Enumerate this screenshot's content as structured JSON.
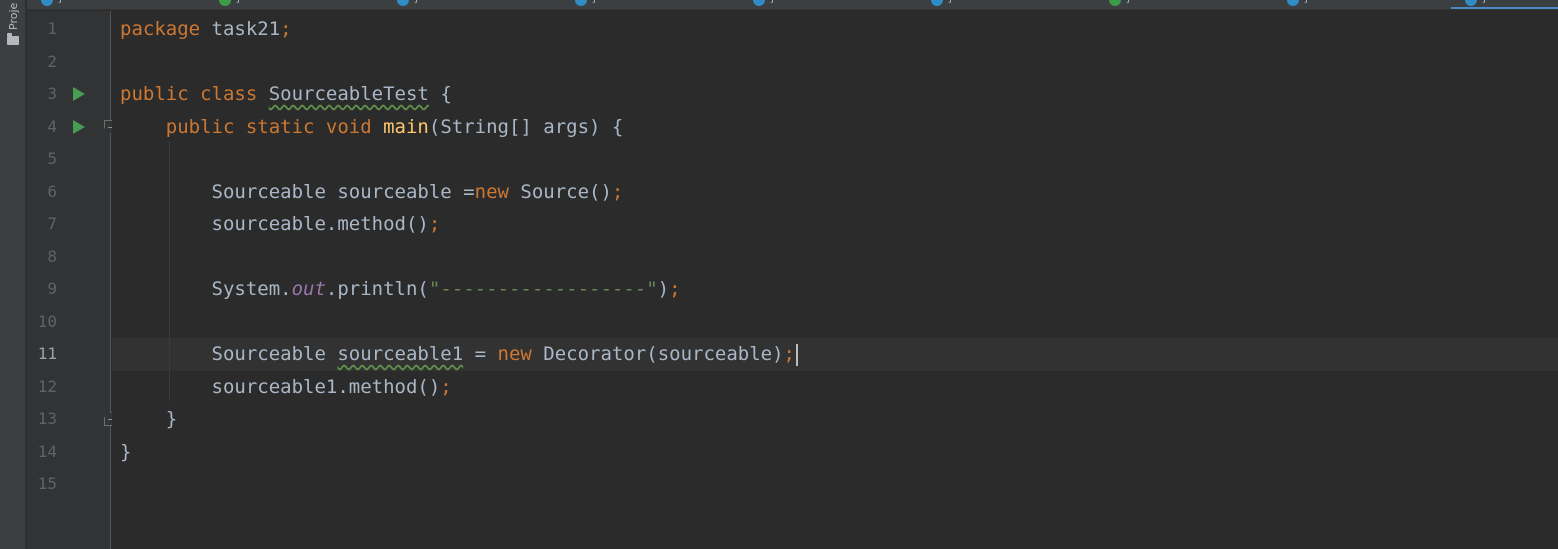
{
  "tool_window": {
    "project_label": "Proje",
    "folder_icon": "folder-icon"
  },
  "tabs": [
    {
      "label": "j",
      "dot_color": "#2f8cc4",
      "active": false
    },
    {
      "label": "j",
      "dot_color": "#3e9b45",
      "active": false
    },
    {
      "label": "j",
      "dot_color": "#2f8cc4",
      "active": false
    },
    {
      "label": "j",
      "dot_color": "#2f8cc4",
      "active": false
    },
    {
      "label": "j",
      "dot_color": "#2f8cc4",
      "active": false
    },
    {
      "label": "j",
      "dot_color": "#2f8cc4",
      "active": false
    },
    {
      "label": "j",
      "dot_color": "#3e9b45",
      "active": false
    },
    {
      "label": "j",
      "dot_color": "#2f8cc4",
      "active": false
    },
    {
      "label": "j",
      "dot_color": "#2f8cc4",
      "active": true
    }
  ],
  "editor": {
    "current_line": 11,
    "line_numbers": [
      "1",
      "2",
      "3",
      "4",
      "5",
      "6",
      "7",
      "8",
      "9",
      "10",
      "11",
      "12",
      "13",
      "14",
      "15"
    ],
    "gutter_markers": {
      "run_lines": [
        3,
        4
      ],
      "fold_open_lines": [
        4
      ],
      "fold_close_lines": [
        13
      ]
    },
    "lines": {
      "l1": {
        "kw_package": "package",
        "name": " task21",
        "semi": ";"
      },
      "l3": {
        "kw_public": "public",
        "kw_class": " class ",
        "class_name": "SourceableTest",
        "brace": " {"
      },
      "l4": {
        "indent": "    ",
        "kw_mods": "public static void ",
        "method": "main",
        "params": "(String[] args) {"
      },
      "l6": {
        "indent": "        ",
        "decl": "Sourceable sourceable =",
        "kw_new": "new",
        "rest": " Source()",
        "semi": ";"
      },
      "l7": {
        "indent": "        ",
        "code": "sourceable.method()",
        "semi": ";"
      },
      "l9": {
        "indent": "        ",
        "obj": "System.",
        "field": "out",
        "call": ".println(",
        "str": "\"------------------\"",
        "close": ")",
        "semi": ";"
      },
      "l11": {
        "indent": "        ",
        "type": "Sourceable ",
        "var": "sourceable1",
        "assign": " = ",
        "kw_new": "new",
        "rest": " Decorator(sourceable)",
        "semi": ";"
      },
      "l12": {
        "indent": "        ",
        "code": "sourceable1.method()",
        "semi": ";"
      },
      "l13": {
        "indent": "    ",
        "brace": "}"
      },
      "l14": {
        "brace": "}"
      }
    }
  }
}
